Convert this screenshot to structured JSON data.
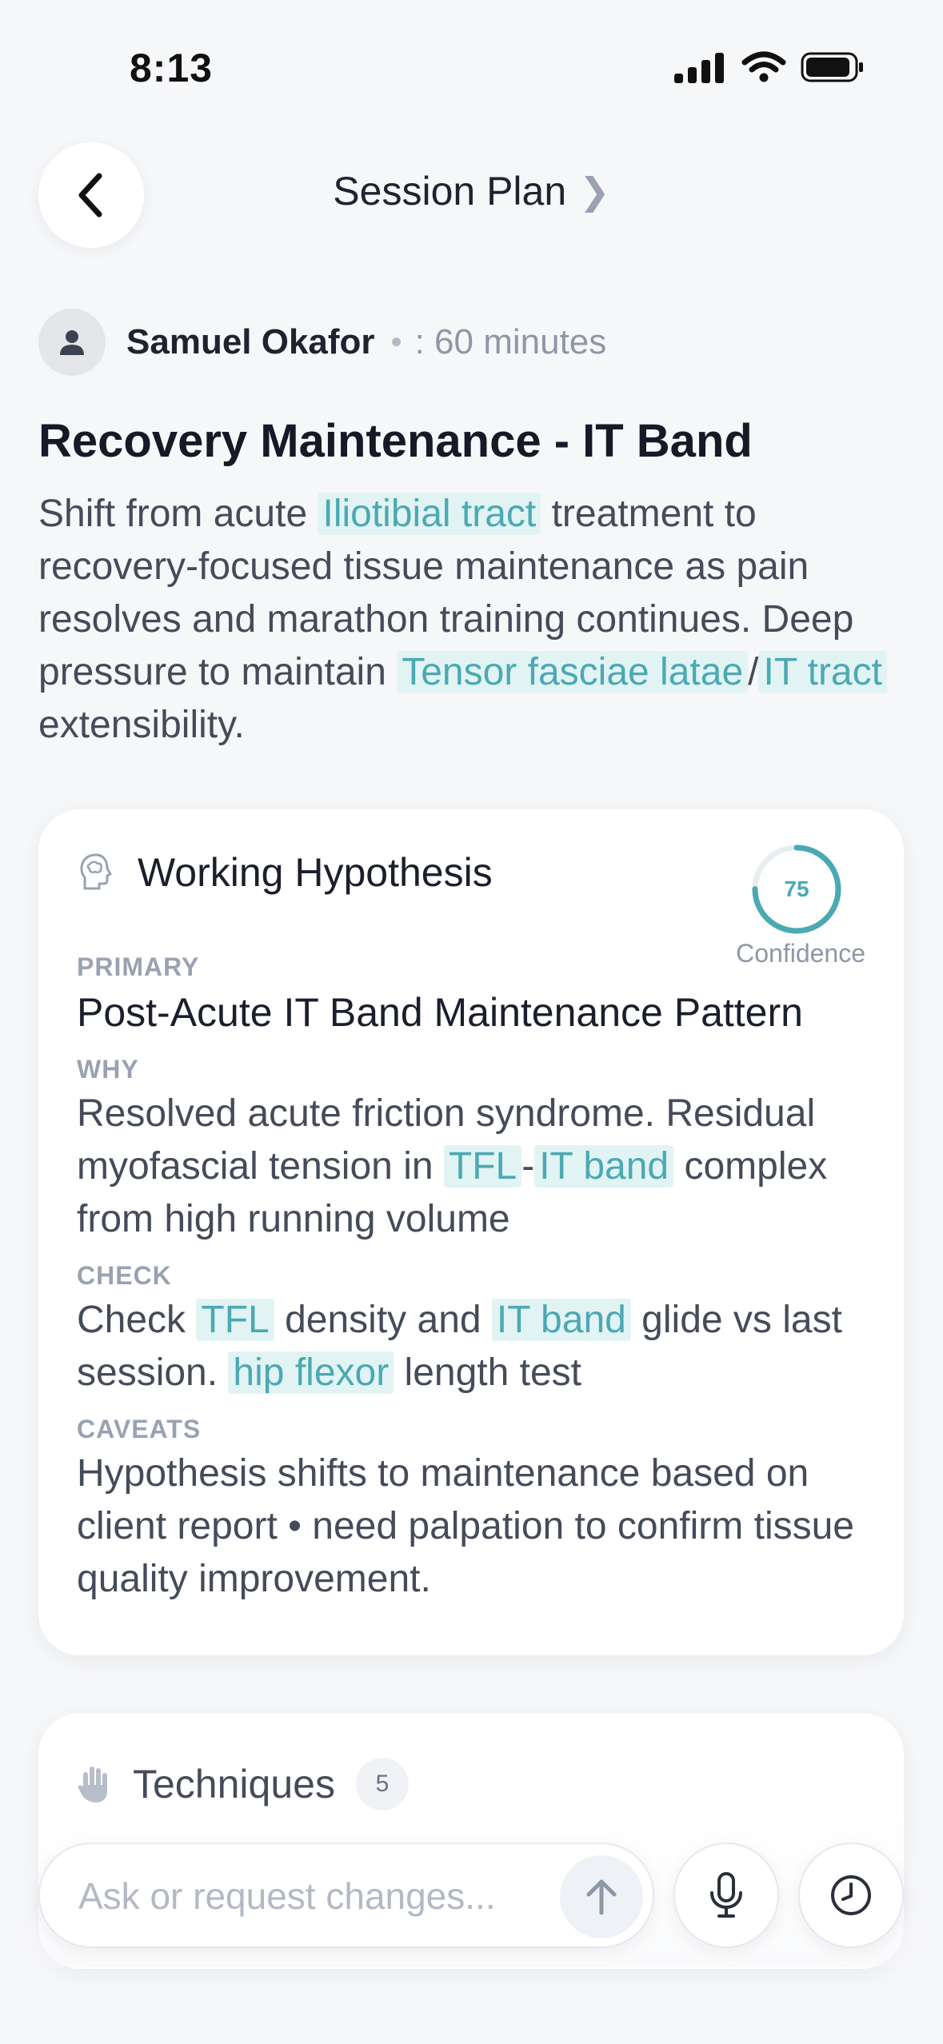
{
  "status_bar": {
    "time": "8:13"
  },
  "header": {
    "title": "Session Plan",
    "chevron": "❯"
  },
  "client": {
    "name": "Samuel Okafor",
    "separator": "•",
    "duration": ": 60 minutes"
  },
  "plan": {
    "title": "Recovery Maintenance - IT Band",
    "desc": {
      "t1": "Shift from acute ",
      "term1": "Iliotibial tract",
      "t2": " treatment to recovery-focused tissue maintenance as pain resolves and marathon training continues. Deep pressure to maintain ",
      "term2": "Tensor fasciae latae",
      "t3": "/",
      "term3": "IT tract",
      "t4": " extensibility."
    }
  },
  "hypothesis": {
    "title": "Working Hypothesis",
    "confidence_value": "75",
    "confidence": 0.75,
    "confidence_label": "Confidence",
    "primary_label": "PRIMARY",
    "primary_text": "Post-Acute IT Band Maintenance Pattern",
    "why_label": "WHY",
    "why": {
      "t1": "Resolved acute friction syndrome. Residual myofascial tension in ",
      "term1": "TFL",
      "t2": "-",
      "term2": "IT band",
      "t3": " complex from high running volume"
    },
    "check_label": "CHECK",
    "check": {
      "t1": "Check ",
      "term1": "TFL",
      "t2": " density and ",
      "term2": "IT band",
      "t3": " glide vs last session. ",
      "term3": "hip flexor",
      "t4": " length test"
    },
    "caveats_label": "CAVEATS",
    "caveats_text": "Hypothesis shifts to maintenance based on client report • need palpation to confirm tissue quality improvement."
  },
  "techniques": {
    "title": "Techniques",
    "count": "5"
  },
  "composer": {
    "placeholder": "Ask or request changes..."
  },
  "colors": {
    "accent": "#4ba9b3",
    "highlight_bg": "#e2f3f4"
  },
  "icons": {
    "back": "back-chevron-icon",
    "brain": "brain-head-icon",
    "hand": "hand-icon",
    "send": "arrow-up-icon",
    "mic": "microphone-icon",
    "history": "clock-icon"
  }
}
